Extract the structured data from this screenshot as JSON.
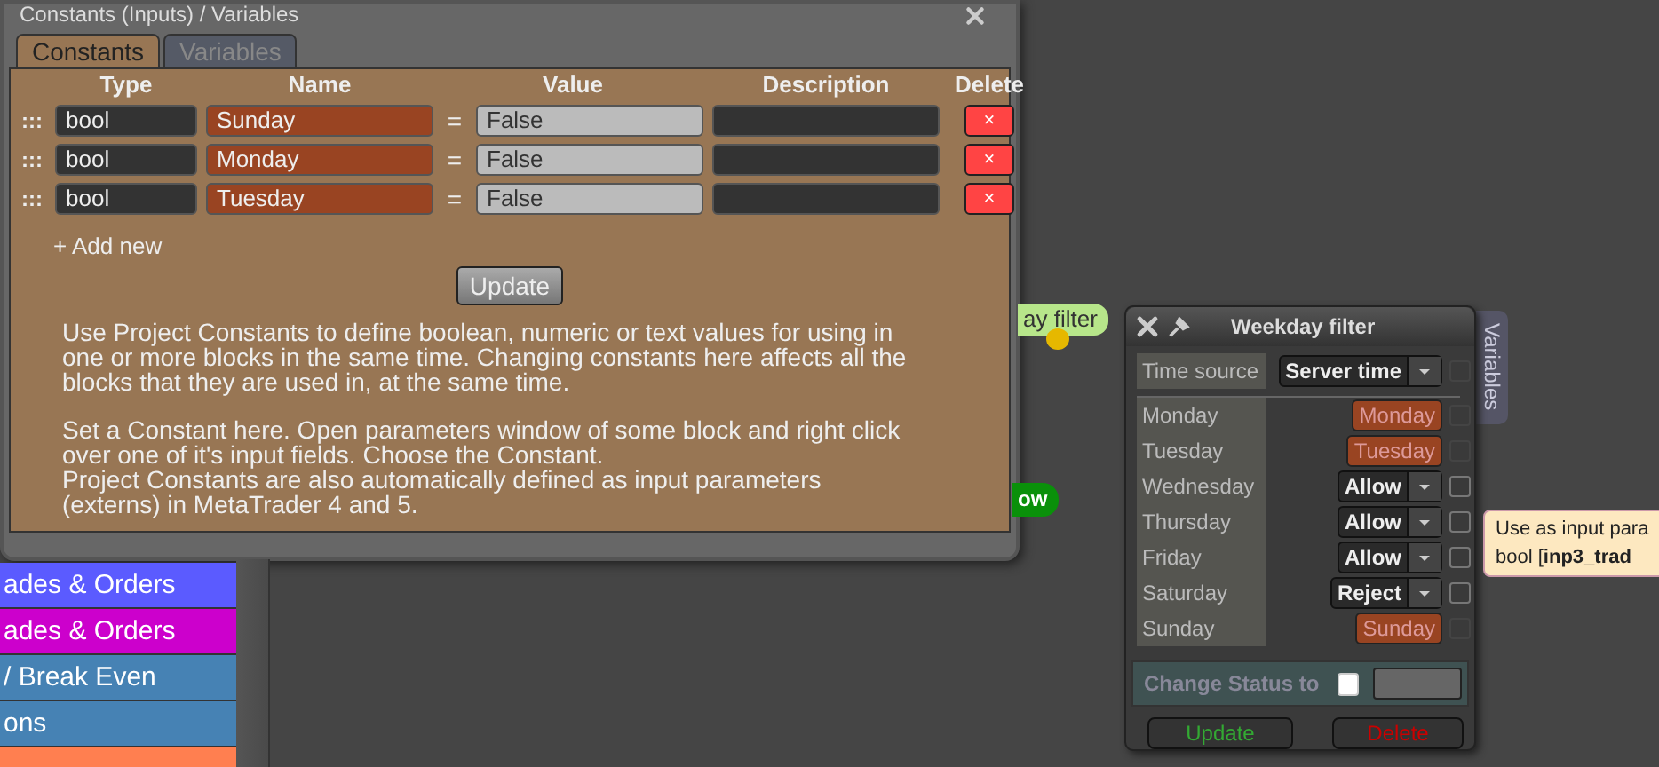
{
  "dialog": {
    "title": "Constants (Inputs) / Variables",
    "tabs": [
      {
        "label": "Constants",
        "selected": true
      },
      {
        "label": "Variables",
        "selected": false
      }
    ],
    "columns": [
      "Type",
      "Name",
      "Value",
      "Description",
      "Delete"
    ],
    "rows": [
      {
        "handle": ":::",
        "type": "bool",
        "name": "Sunday",
        "equals": "=",
        "value": "False",
        "delete": "×"
      },
      {
        "handle": ":::",
        "type": "bool",
        "name": "Monday",
        "equals": "=",
        "value": "False",
        "delete": "×"
      },
      {
        "handle": ":::",
        "type": "bool",
        "name": "Tuesday",
        "equals": "=",
        "value": "False",
        "delete": "×"
      }
    ],
    "add_new": "+ Add new",
    "update": "Update",
    "help": [
      "Use Project Constants to define boolean, numeric or text values for using in one or more blocks in the same time. Changing constants here affects all the blocks that they are used in, at the same time.",
      "Set a Constant here. Open parameters window of some block and right click over one of it's input fields. Choose the Constant.\nProject Constants are also automatically defined as input parameters (externs) in MetaTrader 4 and 5."
    ]
  },
  "sidebar": {
    "items": [
      {
        "label": "ades & Orders",
        "color": "#5b5bff"
      },
      {
        "label": "ades & Orders",
        "color": "#cc00cc"
      },
      {
        "label": "/ Break Even",
        "color": "#4682b4"
      },
      {
        "label": "ons",
        "color": "#4682b4"
      },
      {
        "color": "#ff7f50"
      }
    ]
  },
  "canvas_nodes": [
    {
      "label": "ay filter",
      "kind": "filter"
    },
    {
      "label": "ow",
      "kind": "action"
    }
  ],
  "node_window": {
    "title": "Weekday filter",
    "side_tab": "Variables",
    "time_source": {
      "label": "Time source",
      "value": "Server time",
      "checked": false
    },
    "params": [
      {
        "label": "Monday",
        "kind": "constant",
        "value": "Monday",
        "checked": false
      },
      {
        "label": "Tuesday",
        "kind": "constant",
        "value": "Tuesday",
        "checked": false
      },
      {
        "label": "Wednesday",
        "kind": "select",
        "value": "Allow",
        "checked": false
      },
      {
        "label": "Thursday",
        "kind": "select",
        "value": "Allow",
        "checked": false
      },
      {
        "label": "Friday",
        "kind": "select",
        "value": "Allow",
        "checked": false
      },
      {
        "label": "Saturday",
        "kind": "select",
        "value": "Reject",
        "checked": false
      },
      {
        "label": "Sunday",
        "kind": "constant",
        "value": "Sunday",
        "checked": false
      }
    ],
    "change_status": {
      "label": "Change Status to",
      "checked": false
    },
    "buttons": [
      {
        "label": "Update",
        "kind": "update"
      },
      {
        "label": "Delete",
        "kind": "delete"
      }
    ]
  },
  "tooltip": {
    "lines": [
      "Use as input para",
      "bool [**inp3_trad**"
    ]
  }
}
